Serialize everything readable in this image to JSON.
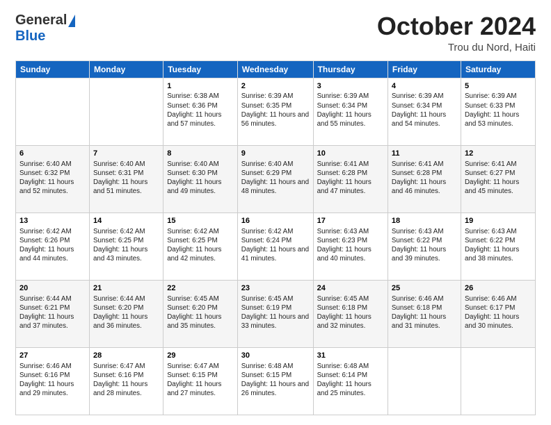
{
  "logo": {
    "general": "General",
    "blue": "Blue"
  },
  "title": "October 2024",
  "location": "Trou du Nord, Haiti",
  "days_of_week": [
    "Sunday",
    "Monday",
    "Tuesday",
    "Wednesday",
    "Thursday",
    "Friday",
    "Saturday"
  ],
  "weeks": [
    [
      {
        "day": "",
        "sunrise": "",
        "sunset": "",
        "daylight": ""
      },
      {
        "day": "",
        "sunrise": "",
        "sunset": "",
        "daylight": ""
      },
      {
        "day": "1",
        "sunrise": "Sunrise: 6:38 AM",
        "sunset": "Sunset: 6:36 PM",
        "daylight": "Daylight: 11 hours and 57 minutes."
      },
      {
        "day": "2",
        "sunrise": "Sunrise: 6:39 AM",
        "sunset": "Sunset: 6:35 PM",
        "daylight": "Daylight: 11 hours and 56 minutes."
      },
      {
        "day": "3",
        "sunrise": "Sunrise: 6:39 AM",
        "sunset": "Sunset: 6:34 PM",
        "daylight": "Daylight: 11 hours and 55 minutes."
      },
      {
        "day": "4",
        "sunrise": "Sunrise: 6:39 AM",
        "sunset": "Sunset: 6:34 PM",
        "daylight": "Daylight: 11 hours and 54 minutes."
      },
      {
        "day": "5",
        "sunrise": "Sunrise: 6:39 AM",
        "sunset": "Sunset: 6:33 PM",
        "daylight": "Daylight: 11 hours and 53 minutes."
      }
    ],
    [
      {
        "day": "6",
        "sunrise": "Sunrise: 6:40 AM",
        "sunset": "Sunset: 6:32 PM",
        "daylight": "Daylight: 11 hours and 52 minutes."
      },
      {
        "day": "7",
        "sunrise": "Sunrise: 6:40 AM",
        "sunset": "Sunset: 6:31 PM",
        "daylight": "Daylight: 11 hours and 51 minutes."
      },
      {
        "day": "8",
        "sunrise": "Sunrise: 6:40 AM",
        "sunset": "Sunset: 6:30 PM",
        "daylight": "Daylight: 11 hours and 49 minutes."
      },
      {
        "day": "9",
        "sunrise": "Sunrise: 6:40 AM",
        "sunset": "Sunset: 6:29 PM",
        "daylight": "Daylight: 11 hours and 48 minutes."
      },
      {
        "day": "10",
        "sunrise": "Sunrise: 6:41 AM",
        "sunset": "Sunset: 6:28 PM",
        "daylight": "Daylight: 11 hours and 47 minutes."
      },
      {
        "day": "11",
        "sunrise": "Sunrise: 6:41 AM",
        "sunset": "Sunset: 6:28 PM",
        "daylight": "Daylight: 11 hours and 46 minutes."
      },
      {
        "day": "12",
        "sunrise": "Sunrise: 6:41 AM",
        "sunset": "Sunset: 6:27 PM",
        "daylight": "Daylight: 11 hours and 45 minutes."
      }
    ],
    [
      {
        "day": "13",
        "sunrise": "Sunrise: 6:42 AM",
        "sunset": "Sunset: 6:26 PM",
        "daylight": "Daylight: 11 hours and 44 minutes."
      },
      {
        "day": "14",
        "sunrise": "Sunrise: 6:42 AM",
        "sunset": "Sunset: 6:25 PM",
        "daylight": "Daylight: 11 hours and 43 minutes."
      },
      {
        "day": "15",
        "sunrise": "Sunrise: 6:42 AM",
        "sunset": "Sunset: 6:25 PM",
        "daylight": "Daylight: 11 hours and 42 minutes."
      },
      {
        "day": "16",
        "sunrise": "Sunrise: 6:42 AM",
        "sunset": "Sunset: 6:24 PM",
        "daylight": "Daylight: 11 hours and 41 minutes."
      },
      {
        "day": "17",
        "sunrise": "Sunrise: 6:43 AM",
        "sunset": "Sunset: 6:23 PM",
        "daylight": "Daylight: 11 hours and 40 minutes."
      },
      {
        "day": "18",
        "sunrise": "Sunrise: 6:43 AM",
        "sunset": "Sunset: 6:22 PM",
        "daylight": "Daylight: 11 hours and 39 minutes."
      },
      {
        "day": "19",
        "sunrise": "Sunrise: 6:43 AM",
        "sunset": "Sunset: 6:22 PM",
        "daylight": "Daylight: 11 hours and 38 minutes."
      }
    ],
    [
      {
        "day": "20",
        "sunrise": "Sunrise: 6:44 AM",
        "sunset": "Sunset: 6:21 PM",
        "daylight": "Daylight: 11 hours and 37 minutes."
      },
      {
        "day": "21",
        "sunrise": "Sunrise: 6:44 AM",
        "sunset": "Sunset: 6:20 PM",
        "daylight": "Daylight: 11 hours and 36 minutes."
      },
      {
        "day": "22",
        "sunrise": "Sunrise: 6:45 AM",
        "sunset": "Sunset: 6:20 PM",
        "daylight": "Daylight: 11 hours and 35 minutes."
      },
      {
        "day": "23",
        "sunrise": "Sunrise: 6:45 AM",
        "sunset": "Sunset: 6:19 PM",
        "daylight": "Daylight: 11 hours and 33 minutes."
      },
      {
        "day": "24",
        "sunrise": "Sunrise: 6:45 AM",
        "sunset": "Sunset: 6:18 PM",
        "daylight": "Daylight: 11 hours and 32 minutes."
      },
      {
        "day": "25",
        "sunrise": "Sunrise: 6:46 AM",
        "sunset": "Sunset: 6:18 PM",
        "daylight": "Daylight: 11 hours and 31 minutes."
      },
      {
        "day": "26",
        "sunrise": "Sunrise: 6:46 AM",
        "sunset": "Sunset: 6:17 PM",
        "daylight": "Daylight: 11 hours and 30 minutes."
      }
    ],
    [
      {
        "day": "27",
        "sunrise": "Sunrise: 6:46 AM",
        "sunset": "Sunset: 6:16 PM",
        "daylight": "Daylight: 11 hours and 29 minutes."
      },
      {
        "day": "28",
        "sunrise": "Sunrise: 6:47 AM",
        "sunset": "Sunset: 6:16 PM",
        "daylight": "Daylight: 11 hours and 28 minutes."
      },
      {
        "day": "29",
        "sunrise": "Sunrise: 6:47 AM",
        "sunset": "Sunset: 6:15 PM",
        "daylight": "Daylight: 11 hours and 27 minutes."
      },
      {
        "day": "30",
        "sunrise": "Sunrise: 6:48 AM",
        "sunset": "Sunset: 6:15 PM",
        "daylight": "Daylight: 11 hours and 26 minutes."
      },
      {
        "day": "31",
        "sunrise": "Sunrise: 6:48 AM",
        "sunset": "Sunset: 6:14 PM",
        "daylight": "Daylight: 11 hours and 25 minutes."
      },
      {
        "day": "",
        "sunrise": "",
        "sunset": "",
        "daylight": ""
      },
      {
        "day": "",
        "sunrise": "",
        "sunset": "",
        "daylight": ""
      }
    ]
  ]
}
